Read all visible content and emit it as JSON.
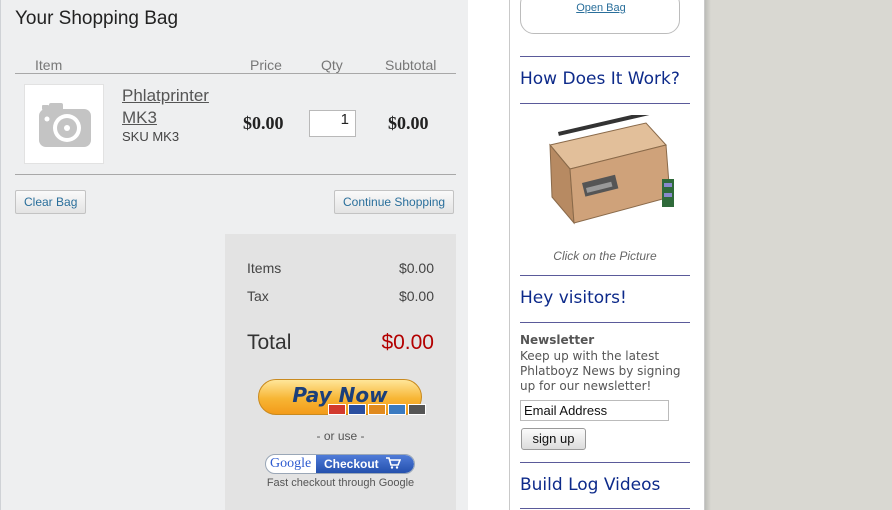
{
  "cart": {
    "title": "Your Shopping Bag",
    "columns": {
      "item": "Item",
      "price": "Price",
      "qty": "Qty",
      "subtotal": "Subtotal"
    },
    "item": {
      "name": "Phlatprinter MK3",
      "sku": "SKU MK3",
      "price": "$0.00",
      "qty": "1",
      "subtotal": "$0.00"
    },
    "clear_label": "Clear Bag",
    "continue_label": "Continue Shopping"
  },
  "summary": {
    "items_label": "Items",
    "items_value": "$0.00",
    "tax_label": "Tax",
    "tax_value": "$0.00",
    "total_label": "Total",
    "total_value": "$0.00",
    "paynow_label": "Pay Now",
    "or_use": "- or use -",
    "google_label": "Google",
    "checkout_label": "Checkout",
    "fast_checkout": "Fast checkout through Google"
  },
  "sidebar": {
    "open_bag": "Open Bag",
    "how_title": "How Does It Work?",
    "caption": "Click on the Picture",
    "visitors_title": "Hey visitors!",
    "newsletter_heading": "Newsletter",
    "newsletter_text": "Keep up with the latest Phlatboyz News by signing up for our newsletter!",
    "email_value": "Email Address",
    "signup_label": "sign up",
    "build_title": "Build Log Videos"
  },
  "colors": {
    "accent_link": "#2a6f9b",
    "total_red": "#b30000",
    "sidebar_title": "#0d2a8a"
  },
  "icons": [
    "camera-placeholder-icon",
    "card-logos-icon",
    "cart-icon"
  ]
}
